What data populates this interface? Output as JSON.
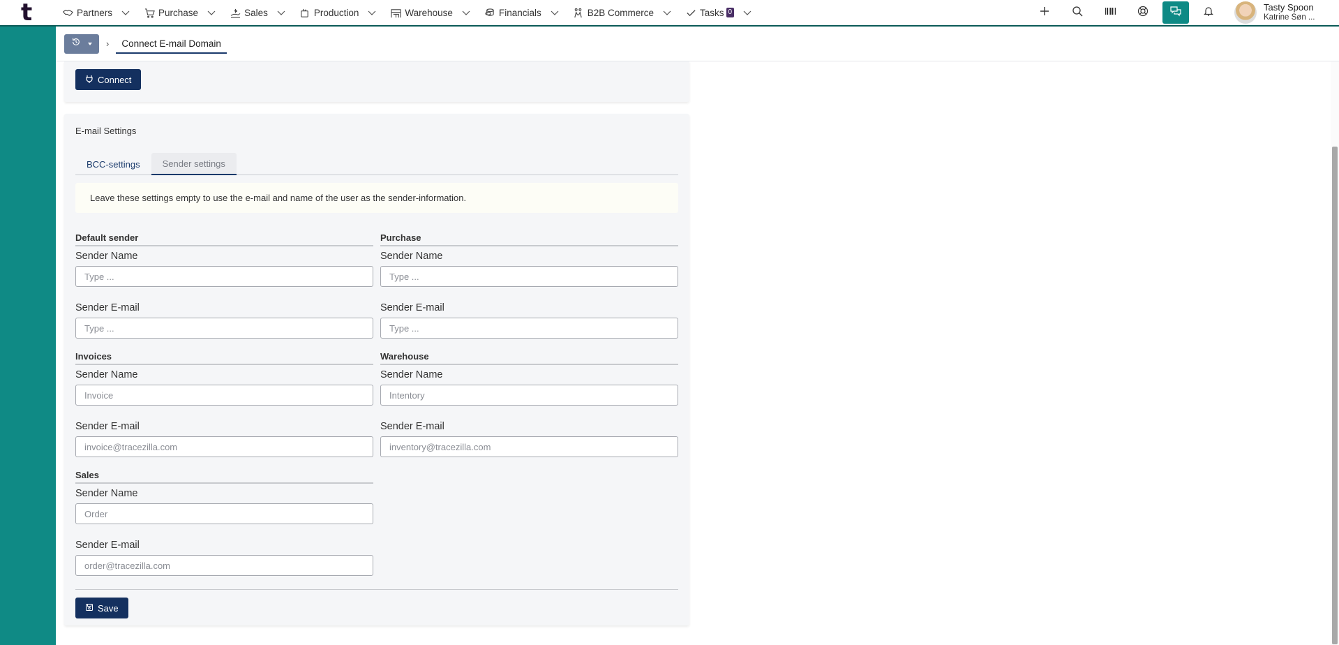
{
  "app": {
    "logo_letter": "t"
  },
  "nav": {
    "items": [
      {
        "label": "Partners",
        "icon": "handshake-icon"
      },
      {
        "label": "Purchase",
        "icon": "cart-icon"
      },
      {
        "label": "Sales",
        "icon": "hand-coin-icon"
      },
      {
        "label": "Production",
        "icon": "pot-icon"
      },
      {
        "label": "Warehouse",
        "icon": "warehouse-icon"
      },
      {
        "label": "Financials",
        "icon": "coins-icon"
      },
      {
        "label": "B2B Commerce",
        "icon": "b2b-icon"
      },
      {
        "label": "Tasks",
        "icon": "check-icon",
        "badge": "0"
      }
    ]
  },
  "toolbar": {
    "tools": [
      "plus-icon",
      "search-icon",
      "barcode-icon",
      "lifebuoy-icon",
      "chat-icon",
      "bell-icon"
    ],
    "active_tool": "chat-icon"
  },
  "user": {
    "name": "Tasty Spoon",
    "subtitle": "Katrine Søn ..."
  },
  "breadcrumb": {
    "current": "Connect E-mail Domain"
  },
  "connect_panel": {
    "button_label": "Connect"
  },
  "email_settings": {
    "title": "E-mail Settings",
    "tabs": [
      {
        "label": "BCC-settings",
        "active": false
      },
      {
        "label": "Sender settings",
        "active": true
      }
    ],
    "notice": "Leave these settings empty to use the e-mail and name of the user as the sender-information.",
    "groups": [
      {
        "title": "Default sender",
        "name_label": "Sender Name",
        "name_value": "",
        "name_placeholder": "Type ...",
        "email_label": "Sender E-mail",
        "email_value": "",
        "email_placeholder": "Type ..."
      },
      {
        "title": "Purchase",
        "name_label": "Sender Name",
        "name_value": "",
        "name_placeholder": "Type ...",
        "email_label": "Sender E-mail",
        "email_value": "",
        "email_placeholder": "Type ..."
      },
      {
        "title": "Invoices",
        "name_label": "Sender Name",
        "name_value": "",
        "name_placeholder": "Invoice",
        "email_label": "Sender E-mail",
        "email_value": "",
        "email_placeholder": "invoice@tracezilla.com"
      },
      {
        "title": "Warehouse",
        "name_label": "Sender Name",
        "name_value": "",
        "name_placeholder": "Intentory",
        "email_label": "Sender E-mail",
        "email_value": "",
        "email_placeholder": "inventory@tracezilla.com"
      },
      {
        "title": "Sales",
        "name_label": "Sender Name",
        "name_value": "",
        "name_placeholder": "Order",
        "email_label": "Sender E-mail",
        "email_value": "",
        "email_placeholder": "order@tracezilla.com"
      }
    ],
    "save_label": "Save"
  }
}
